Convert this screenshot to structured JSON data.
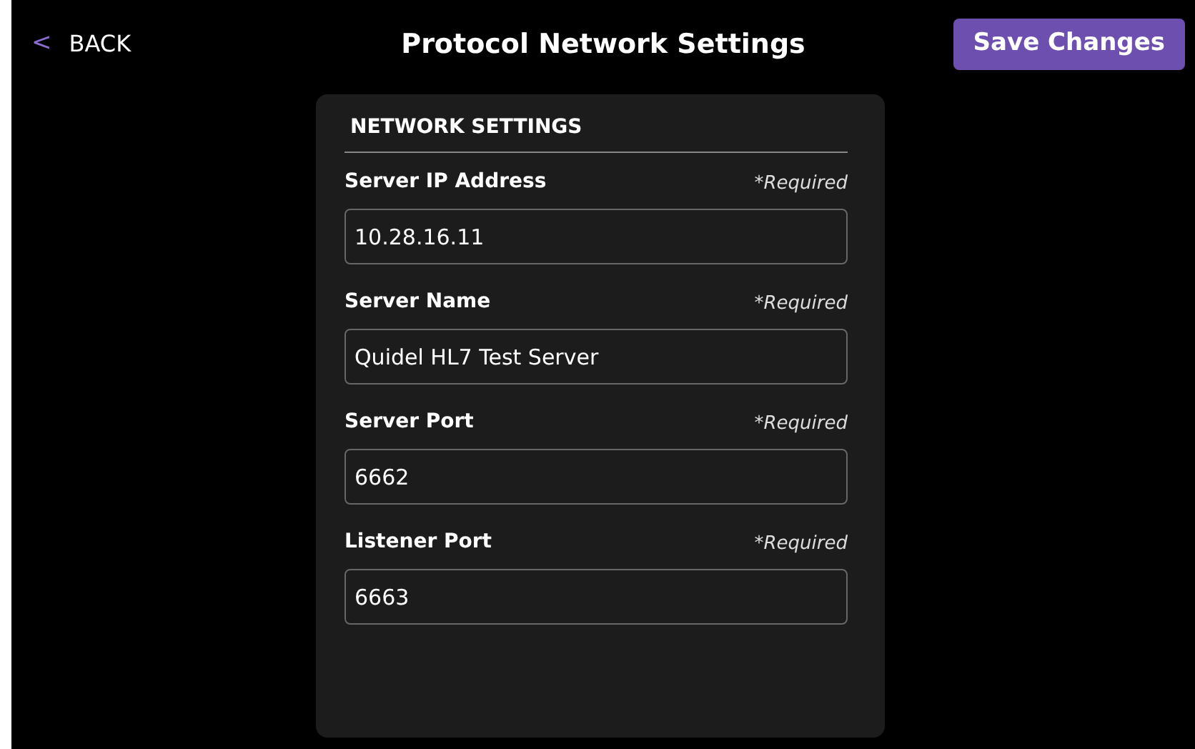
{
  "header": {
    "back": {
      "icon": "<",
      "label": "BACK"
    },
    "title": "Protocol Network Settings",
    "save_button": "Save Changes"
  },
  "section": {
    "title": "NETWORK SETTINGS",
    "fields": [
      {
        "label": "Server IP Address",
        "hint": "*Required",
        "value": "10.28.16.11"
      },
      {
        "label": "Server Name",
        "hint": "*Required",
        "value": "Quidel HL7 Test Server"
      },
      {
        "label": "Server Port",
        "hint": "*Required",
        "value": "6662"
      },
      {
        "label": "Listener Port",
        "hint": "*Required",
        "value": "6663"
      }
    ]
  }
}
